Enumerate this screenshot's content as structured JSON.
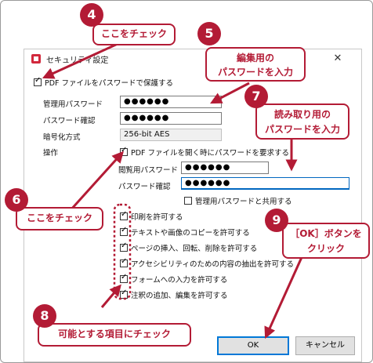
{
  "dialog": {
    "title": "セキュリティ設定",
    "protect_label": "PDF ファイルをパスワードで保護する",
    "perm_password_label": "管理用パスワード",
    "perm_password_value": "●●●●●●",
    "perm_confirm_label": "パスワード確認",
    "perm_confirm_value": "●●●●●●",
    "encryption_label": "暗号化方式",
    "encryption_value": "256-bit AES",
    "operations_label": "操作",
    "require_open_label": "PDF ファイルを開く時にパスワードを要求する",
    "open_password_label": "閲覧用パスワード",
    "open_password_value": "●●●●●●",
    "open_confirm_label": "パスワード確認",
    "open_confirm_value": "●●●●●●",
    "share_label": "管理用パスワードと共用する",
    "permissions": [
      "印刷を許可する",
      "テキストや画像のコピーを許可する",
      "ページの挿入、回転、削除を許可する",
      "アクセシビリティのための内容の抽出を許可する",
      "フォームへの入力を許可する",
      "注釈の追加、編集を許可する"
    ],
    "ok_label": "OK",
    "cancel_label": "キャンセル",
    "close_glyph": "✕"
  },
  "callouts": {
    "c4": {
      "num": "4",
      "text": "ここをチェック"
    },
    "c5": {
      "num": "5",
      "line1": "編集用の",
      "line2": "パスワードを入力"
    },
    "c6": {
      "num": "6",
      "text": "ここをチェック"
    },
    "c7": {
      "num": "7",
      "line1": "読み取り用の",
      "line2": "パスワードを入力"
    },
    "c8": {
      "num": "8",
      "text": "可能とする項目にチェック"
    },
    "c9": {
      "num": "9",
      "line1": "［OK］ボタンを",
      "line2": "クリック"
    }
  },
  "colors": {
    "accent": "#b31b35",
    "focus": "#0067c0"
  }
}
